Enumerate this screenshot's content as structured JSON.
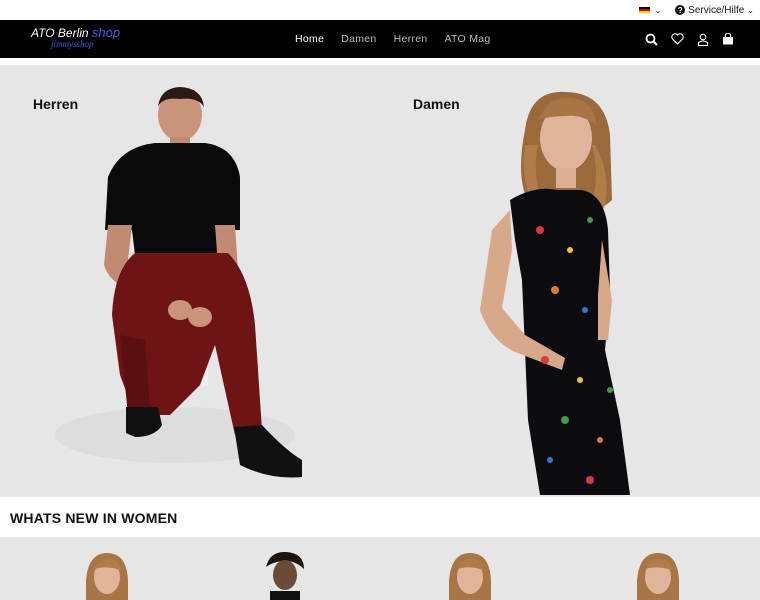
{
  "utility": {
    "flag_colors": [
      "#000000",
      "#dd0000",
      "#ffce00"
    ],
    "service_label": "Service/Hilfe",
    "service_icon": "question-circle-icon"
  },
  "logo": {
    "line1": "ATO Berlin",
    "line1_shop": "shop",
    "line2": "jimmysshop"
  },
  "nav": {
    "items": [
      {
        "label": "Home",
        "active": true
      },
      {
        "label": "Damen",
        "active": false
      },
      {
        "label": "Herren",
        "active": false
      },
      {
        "label": "ATO Mag",
        "active": false
      }
    ],
    "icons": [
      "search-icon",
      "heart-icon",
      "user-icon",
      "cart-icon"
    ]
  },
  "hero": {
    "left_label": "Herren",
    "right_label": "Damen",
    "background": "#e6e6e6"
  },
  "section": {
    "title": "WHATS NEW IN WOMEN"
  },
  "colors": {
    "nav_bg": "#000000",
    "logo_accent": "#3b5bdb"
  }
}
